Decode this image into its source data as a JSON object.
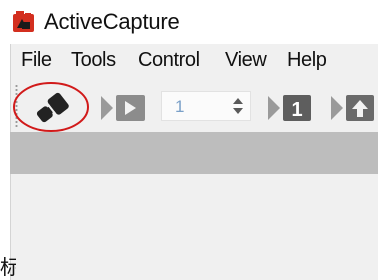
{
  "app": {
    "title": "ActiveCapture",
    "icon": "active-capture-logo"
  },
  "menu": {
    "items": [
      {
        "label": "File"
      },
      {
        "label": "Tools"
      },
      {
        "label": "Control"
      },
      {
        "label": "View"
      },
      {
        "label": "Help"
      }
    ]
  },
  "toolbar": {
    "connect_icon": "plug-connect-icon",
    "highlight_color": "#d11a1a",
    "play_icon": "play-icon",
    "step_value": "1",
    "spinner_icon": "up-down-arrows-icon",
    "step_icon": "step-one-icon",
    "export_icon": "step-upload-icon"
  },
  "footer_fragment": "标"
}
